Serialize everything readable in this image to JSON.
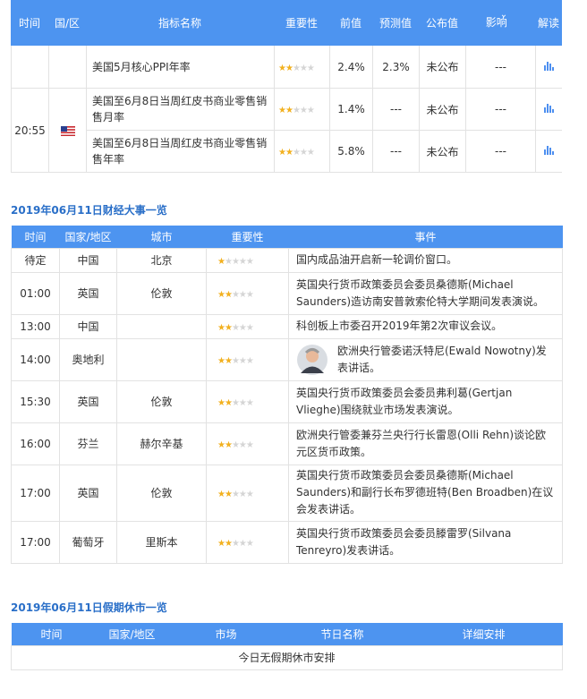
{
  "top_table": {
    "headers": {
      "time": "时间",
      "country": "国/区",
      "indicator": "指标名称",
      "importance": "重要性",
      "previous": "前值",
      "forecast": "预测值",
      "actual": "公布值",
      "impact": "影响",
      "impact_icon": "chevron-down-icon",
      "interpret": "解读"
    },
    "rows": [
      {
        "indicator": "美国5月核心PPI年率",
        "stars": 2,
        "previous": "2.4%",
        "forecast": "2.3%",
        "actual": "未公布",
        "impact": "---"
      },
      {
        "indicator": "美国至6月8日当周红皮书商业零售销售月率",
        "stars": 2,
        "previous": "1.4%",
        "forecast": "---",
        "actual": "未公布",
        "impact": "---"
      },
      {
        "indicator": "美国至6月8日当周红皮书商业零售销售年率",
        "stars": 2,
        "previous": "5.8%",
        "forecast": "---",
        "actual": "未公布",
        "impact": "---"
      }
    ],
    "group_time": "20:55",
    "flag": "us-flag"
  },
  "events": {
    "title": "2019年06月11日财经大事一览",
    "headers": {
      "time": "时间",
      "country": "国家/地区",
      "city": "城市",
      "importance": "重要性",
      "event": "事件"
    },
    "rows": [
      {
        "time": "待定",
        "country": "中国",
        "city": "北京",
        "stars": 1,
        "event": "国内成品油开启新一轮调价窗口。"
      },
      {
        "time": "01:00",
        "country": "英国",
        "city": "伦敦",
        "stars": 2,
        "event": "英国央行货币政策委员会委员桑德斯(Michael Saunders)造访南安普敦索伦特大学期间发表演说。"
      },
      {
        "time": "13:00",
        "country": "中国",
        "city": "",
        "stars": 2,
        "event": "科创板上市委召开2019年第2次审议会议。"
      },
      {
        "time": "14:00",
        "country": "奥地利",
        "city": "",
        "stars": 2,
        "event": "欧洲央行管委诺沃特尼(Ewald Nowotny)发表讲话。",
        "avatar": true
      },
      {
        "time": "15:30",
        "country": "英国",
        "city": "伦敦",
        "stars": 2,
        "event": "英国央行货币政策委员会委员弗利葛(Gertjan Vlieghe)围绕就业市场发表演说。"
      },
      {
        "time": "16:00",
        "country": "芬兰",
        "city": "赫尔辛基",
        "stars": 2,
        "event": "欧洲央行管委兼芬兰央行行长雷恩(Olli Rehn)谈论欧元区货币政策。"
      },
      {
        "time": "17:00",
        "country": "英国",
        "city": "伦敦",
        "stars": 2,
        "event": "英国央行货币政策委员会委员桑德斯(Michael Saunders)和副行长布罗德班特(Ben Broadben)在议会发表讲话。"
      },
      {
        "time": "17:00",
        "country": "葡萄牙",
        "city": "里斯本",
        "stars": 2,
        "event": "英国央行货币政策委员会委员滕雷罗(Silvana Tenreyro)发表讲话。"
      }
    ]
  },
  "holidays": {
    "title": "2019年06月11日假期休市一览",
    "headers": {
      "time": "时间",
      "country": "国家/地区",
      "market": "市场",
      "holiday": "节日名称",
      "detail": "详细安排"
    },
    "empty": "今日无假期休市安排"
  },
  "colors": {
    "header_blue": "#4d94f0",
    "title_blue": "#2a6fc8",
    "star_on": "#f2b01e",
    "star_off": "#d5d5d5"
  }
}
